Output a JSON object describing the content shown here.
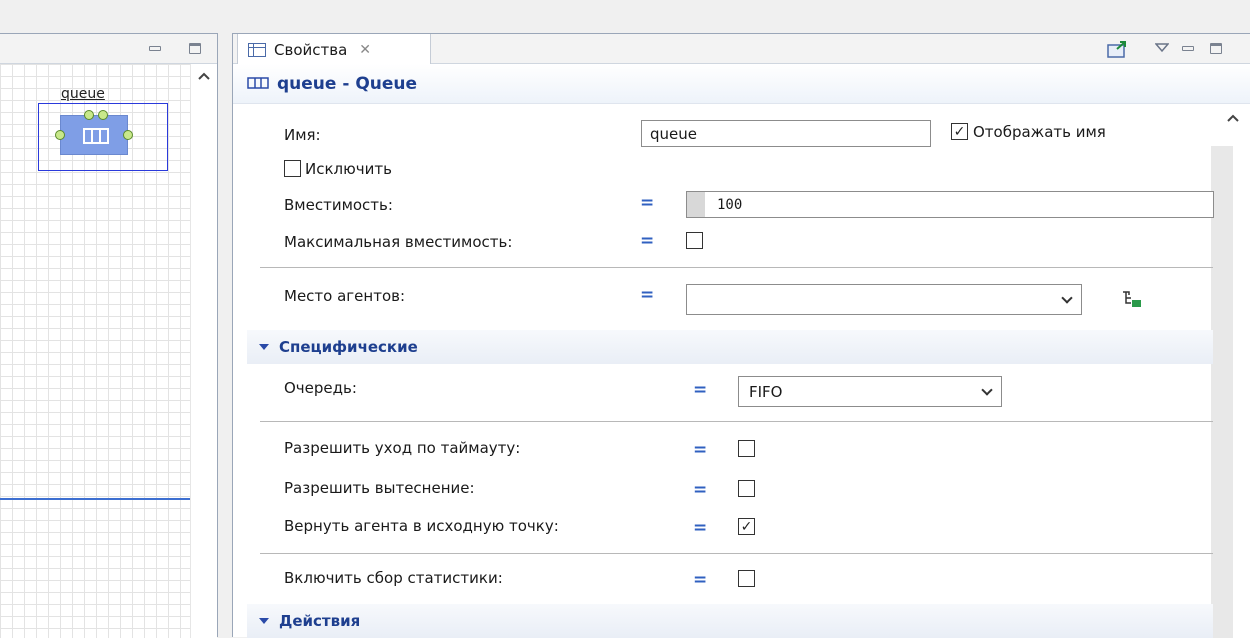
{
  "canvas": {
    "block_label": "queue"
  },
  "properties": {
    "tab_title": "Свойства",
    "tab_close": "✕",
    "object_title": "queue - Queue",
    "name_label": "Имя:",
    "name_value": "queue",
    "show_name_label": "Отображать имя",
    "show_name_checked": true,
    "exclude_label": "Исключить",
    "exclude_checked": false,
    "capacity_label": "Вместимость:",
    "capacity_value": "100",
    "max_capacity_label": "Максимальная вместимость:",
    "max_capacity_checked": false,
    "agent_location_label": "Место агентов:",
    "agent_location_value": ""
  },
  "specific": {
    "title": "Специфические",
    "queue_label": "Очередь:",
    "queue_value": "FIFO",
    "timeout_label": "Разрешить уход по таймауту:",
    "timeout_checked": false,
    "preemption_label": "Разрешить вытеснение:",
    "preemption_checked": false,
    "return_label": "Вернуть агента в исходную точку:",
    "return_checked": true,
    "stats_label": "Включить сбор статистики:",
    "stats_checked": false
  },
  "actions": {
    "title": "Действия"
  },
  "colors": {
    "accent": "#1e3f8f",
    "selection": "#2a3adb",
    "block": "#7f9ee6"
  }
}
